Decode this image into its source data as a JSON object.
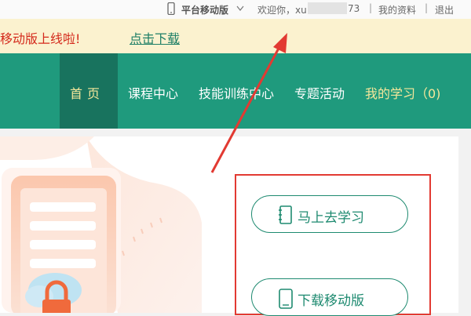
{
  "topbar": {
    "platform_label": "平台移动版",
    "welcome_prefix": "欢迎你，xu",
    "welcome_suffix": "73",
    "profile_link": "我的资料",
    "logout_link": "退出",
    "separator": "|"
  },
  "notice": {
    "message": "移动版上线啦!",
    "download_link": "点击下载"
  },
  "nav": {
    "items": [
      "首页",
      "课程中心",
      "技能训练中心",
      "专题活动",
      "我的学习（0)"
    ]
  },
  "actions": {
    "study_now": "马上去学习",
    "download_mobile": "下载移动版"
  },
  "colors": {
    "nav_green": "#1f9a7d",
    "nav_active": "#18735e",
    "accent_yellow": "#f5e79b",
    "notice_red": "#d42a1c",
    "highlight_red": "#e23a32"
  }
}
